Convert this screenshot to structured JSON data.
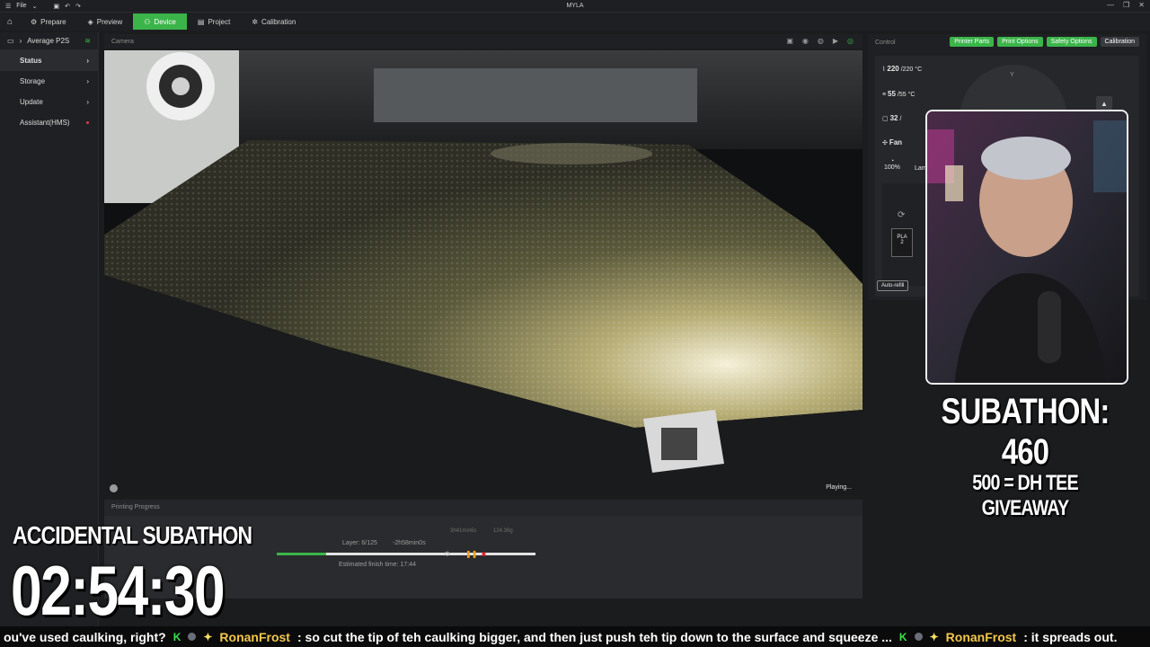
{
  "window": {
    "title": "MYLA",
    "menu_file": "File"
  },
  "tabs": [
    {
      "label": "Prepare"
    },
    {
      "label": "Preview"
    },
    {
      "label": "Device"
    },
    {
      "label": "Project"
    },
    {
      "label": "Calibration"
    }
  ],
  "sidebar": {
    "device_name": "Average P2S",
    "items": [
      {
        "label": "Status"
      },
      {
        "label": "Storage"
      },
      {
        "label": "Update"
      },
      {
        "label": "Assistant(HMS)"
      }
    ]
  },
  "camera": {
    "header": "Camera",
    "status": "Playing..."
  },
  "progress": {
    "header": "Printing Progress",
    "layer": "Layer: 6/125",
    "remaining": "-2h58min0s",
    "eta": "Estimated finish time: 17:44",
    "time_small": "3h41min6s",
    "weight_small": "124.39g",
    "fraction": 0.19
  },
  "control": {
    "header": "Control",
    "tabs": [
      "Printer Parts",
      "Print Options",
      "Safety Options",
      "Calibration"
    ],
    "nozzle": {
      "current": "220",
      "target": "/220",
      "unit": "°C"
    },
    "bed": {
      "current": "55",
      "target": "/55",
      "unit": "°C"
    },
    "chamber": {
      "current": "32",
      "target": "/"
    },
    "fan_label": "Fan",
    "fan_pct": "100%",
    "lamp_label": "Lam",
    "filament": "PLA",
    "filament_slot": "2",
    "auto_refill": "Auto-refill",
    "jog_label": "Y"
  },
  "overlay": {
    "subathon_count": "SUBATHON: 460",
    "subathon_goal": "500 = DH TEE GIVEAWAY",
    "accidental": "ACCIDENTAL SUBATHON",
    "timer": "02:54:30"
  },
  "ticker": {
    "lead": "ou've used caulking, right?",
    "user1": "RonanFrost",
    "msg1": ": so cut the tip of teh caulking bigger, and then just push teh tip down to the surface and squeeze ...",
    "user2": "RonanFrost",
    "msg2": ": it spreads out."
  }
}
